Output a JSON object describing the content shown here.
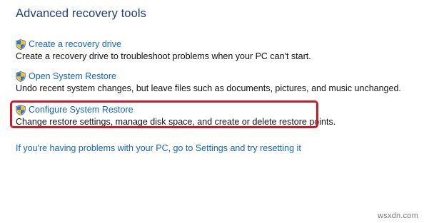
{
  "section": {
    "title": "Advanced recovery tools"
  },
  "tools": [
    {
      "link": "Create a recovery drive",
      "description": "Create a recovery drive to troubleshoot problems when your PC can't start.",
      "icon": "uac-shield-icon"
    },
    {
      "link": "Open System Restore",
      "description": "Undo recent system changes, but leave files such as documents, pictures, and music unchanged.",
      "icon": "uac-shield-icon"
    },
    {
      "link": "Configure System Restore",
      "description": "Change restore settings, manage disk space, and create or delete restore points.",
      "icon": "uac-shield-icon"
    }
  ],
  "reset_link": "If you're having problems with your PC, go to Settings and try resetting it",
  "watermark": "wsxdn.com",
  "colors": {
    "heading": "#1f3d7a",
    "link": "#1565c0",
    "highlight": "#d2172a"
  }
}
